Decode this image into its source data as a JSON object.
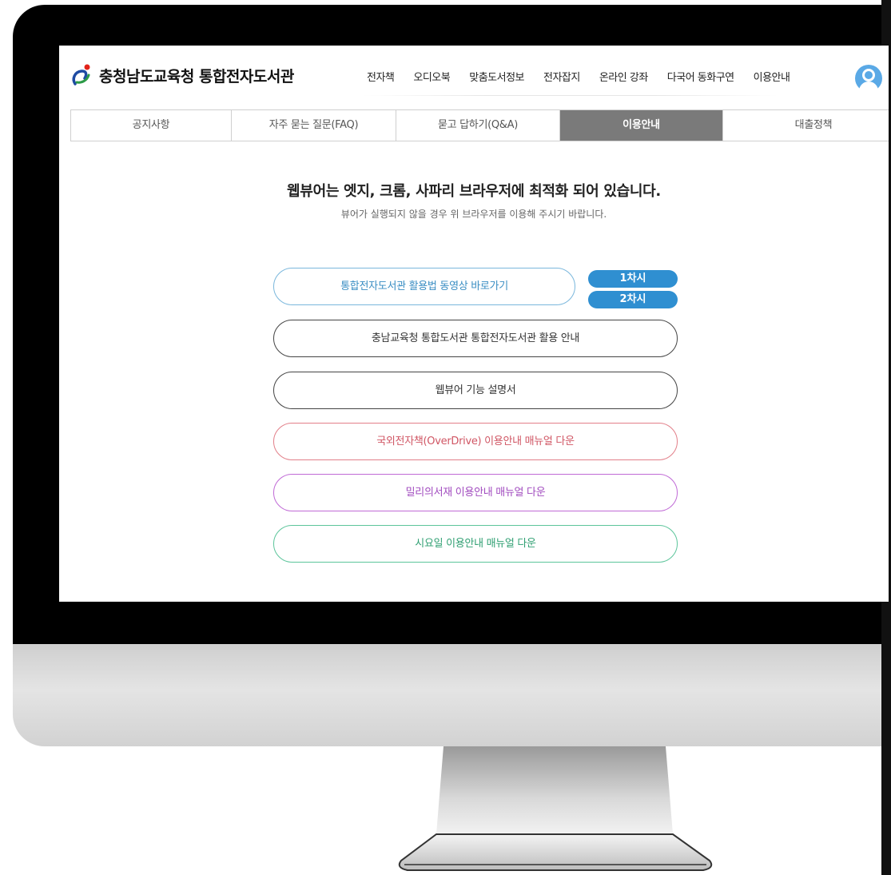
{
  "site": {
    "title": "충청남도교육청 통합전자도서관"
  },
  "nav": [
    "전자책",
    "오디오북",
    "맞춤도서정보",
    "전자잡지",
    "온라인 강좌",
    "다국어 동화구연",
    "이용안내"
  ],
  "subtabs": {
    "items": [
      "공지사항",
      "자주 묻는 질문(FAQ)",
      "묻고 답하기(Q&A)",
      "이용안내",
      "대출정책"
    ],
    "active": "이용안내"
  },
  "main": {
    "headline": "웹뷰어는 엣지, 크롬, 사파리 브라우저에 최적화 되어 있습니다.",
    "subline": "뷰어가 실행되지 않을 경우 위 브라우저를 이용해 주시기 바랍니다.",
    "video_button": "통합전자도서관 활용법 동영상 바로가기",
    "session_buttons": [
      "1차시",
      "2차시"
    ],
    "links": [
      "충남교육청 통합도서관 통합전자도서관 활용 안내",
      "웹뷰어 기능 설명서",
      "국외전자책(OverDrive) 이용안내 매뉴얼 다운",
      "밀리의서재 이용안내 매뉴얼 다운",
      "시요일 이용안내 매뉴얼 다운"
    ]
  },
  "colors": {
    "accent_blue": "#2f8fd1",
    "active_tab": "#7a7a7a",
    "red_link": "#d05664",
    "purple_link": "#a14bbf",
    "green_link": "#2f9f72"
  }
}
